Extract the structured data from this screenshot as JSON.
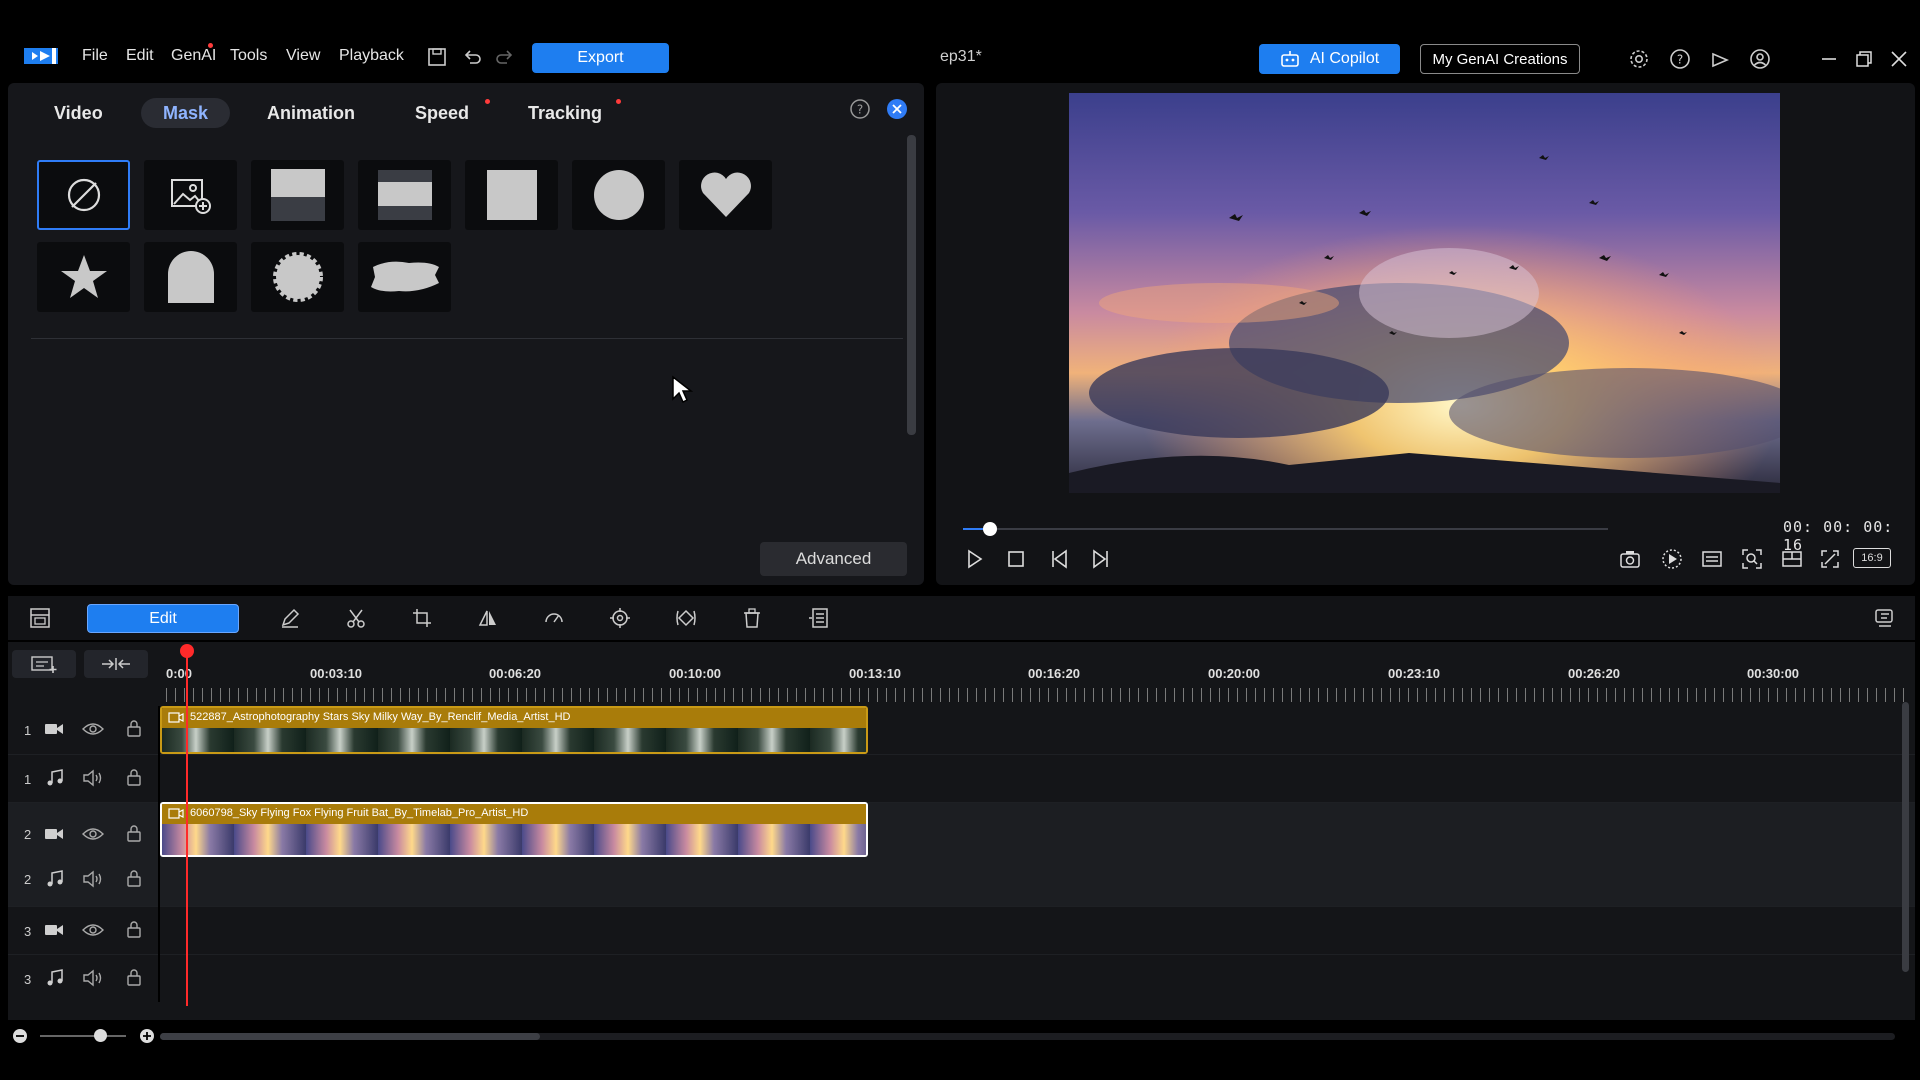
{
  "menu": {
    "items": [
      "File",
      "Edit",
      "GenAI",
      "Tools",
      "View",
      "Playback"
    ],
    "export_label": "Export",
    "doc_title": "ep31*",
    "copilot_label": "AI Copilot",
    "genai_creations_label": "My GenAI Creations"
  },
  "mask_panel": {
    "tabs": [
      "Video",
      "Mask",
      "Animation",
      "Speed",
      "Tracking"
    ],
    "active_tab": "Mask",
    "tiles": [
      "none-mask-icon",
      "image-mask-icon",
      "top-half-icon",
      "middle-band-icon",
      "square-icon",
      "circle-icon",
      "heart-icon",
      "star-icon",
      "arch-icon",
      "starburst-icon",
      "brush-stroke-icon"
    ],
    "advanced_label": "Advanced"
  },
  "preview": {
    "timecode": "00: 00: 00: 16",
    "aspect_label": "16:9",
    "progress": 0.037
  },
  "timeline": {
    "edit_label": "Edit",
    "ruler": [
      "0:00",
      "00:03:10",
      "00:06:20",
      "00:10:00",
      "00:13:10",
      "00:16:20",
      "00:20:00",
      "00:23:10",
      "00:26:20",
      "00:30:00"
    ],
    "tracks": [
      {
        "num": "1",
        "type": "video"
      },
      {
        "num": "1",
        "type": "audio"
      },
      {
        "num": "2",
        "type": "video"
      },
      {
        "num": "2",
        "type": "audio"
      },
      {
        "num": "3",
        "type": "video"
      },
      {
        "num": "3",
        "type": "audio"
      }
    ],
    "clips": [
      {
        "title": "522887_Astrophotography Stars Sky Milky Way_By_Renclif_Media_Artist_HD"
      },
      {
        "title": "6060798_Sky Flying Fox Flying Fruit Bat_By_Timelab_Pro_Artist_HD"
      }
    ]
  },
  "colors": {
    "accent": "#1e7ef0",
    "clip_border": "#c99a16",
    "playhead": "#ff2a2a"
  }
}
